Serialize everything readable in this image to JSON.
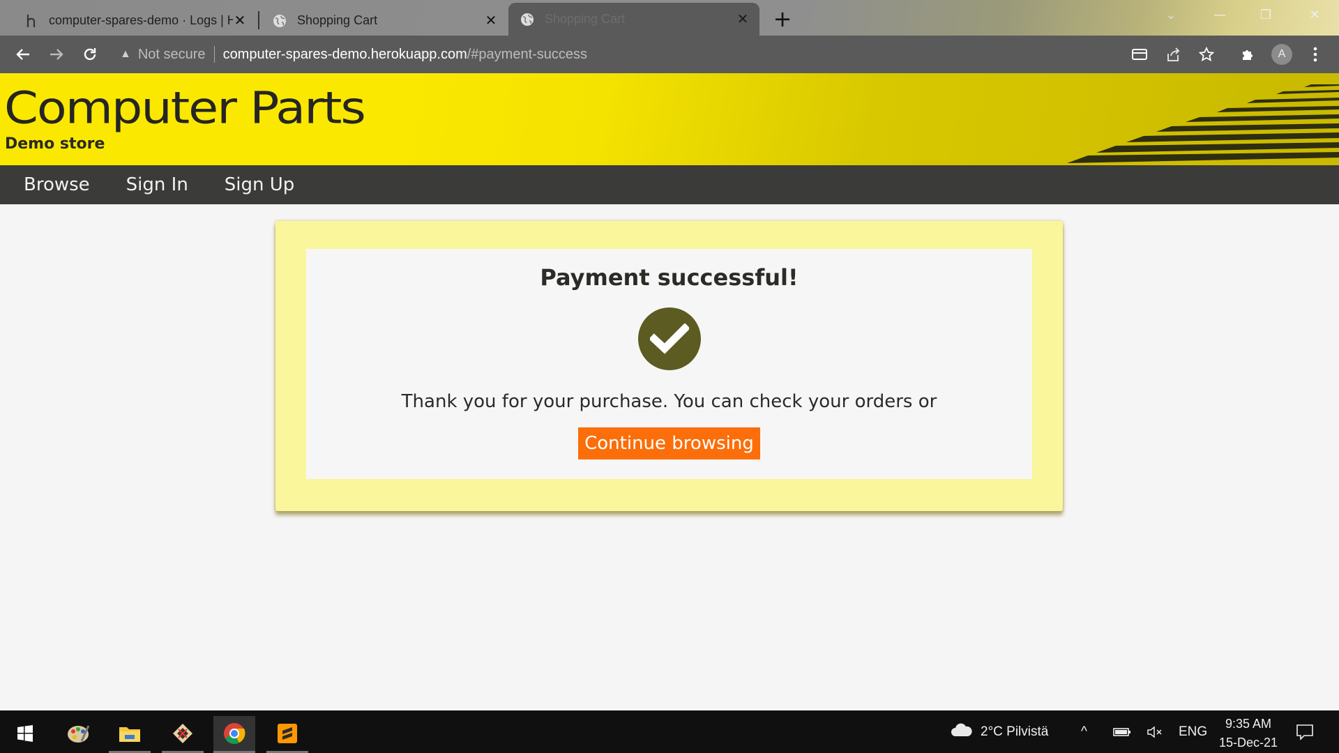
{
  "browser": {
    "tabs": [
      {
        "title": "computer-spares-demo · Logs | H",
        "favicon": "heroku-icon"
      },
      {
        "title": "Shopping Cart",
        "favicon": "globe-icon"
      },
      {
        "title": "Shopping Cart",
        "favicon": "globe-icon",
        "active": true
      }
    ],
    "address": {
      "security": "Not secure",
      "host": "computer-spares-demo.herokuapp.com",
      "path": "/#payment-success"
    },
    "profile_initial": "A"
  },
  "site": {
    "brand": "Computer Parts",
    "tagline": "Demo store",
    "nav": [
      "Browse",
      "Sign In",
      "Sign Up"
    ]
  },
  "success": {
    "heading": "Payment successful!",
    "message": "Thank you for your purchase. You can check your orders or",
    "button": "Continue browsing"
  },
  "taskbar": {
    "weather": "2°C Pilvistä",
    "language": "ENG",
    "time": "9:35 AM",
    "date": "15-Dec-21"
  },
  "colors": {
    "banner_yellow": "#fbe800",
    "card_yellow": "#faf69c",
    "cta_orange": "#fb6e0a",
    "nav_dark": "#3b3b3a",
    "check_olive": "#5b5b22"
  }
}
